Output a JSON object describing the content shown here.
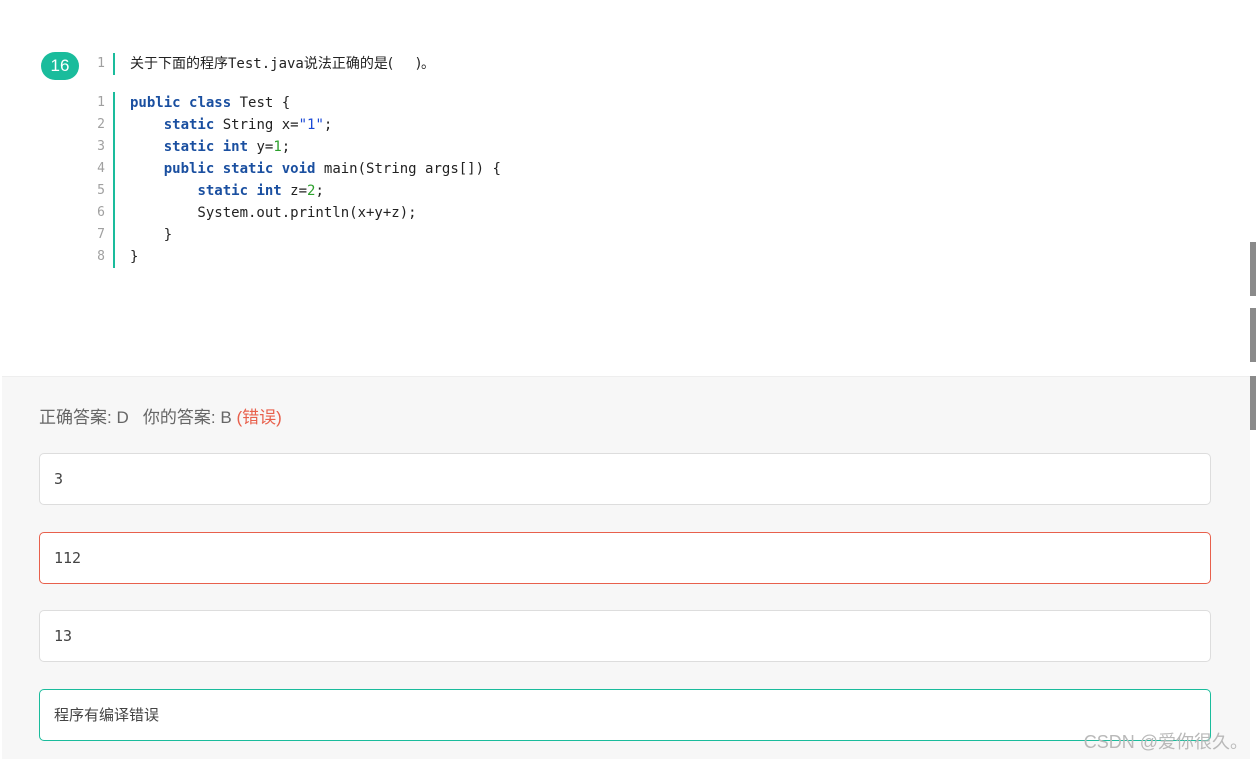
{
  "question": {
    "number": "16",
    "prompt_line_no": "1",
    "prompt_before": "关于下面的程序",
    "prompt_code": "Test.java",
    "prompt_after": "说法正确的是(     )。",
    "code_lines": [
      {
        "no": "1",
        "tokens": [
          {
            "t": "kw",
            "v": "public"
          },
          {
            "t": "p",
            "v": " "
          },
          {
            "t": "kw",
            "v": "class"
          },
          {
            "t": "p",
            "v": " Test {"
          }
        ]
      },
      {
        "no": "2",
        "tokens": [
          {
            "t": "p",
            "v": "    "
          },
          {
            "t": "kw",
            "v": "static"
          },
          {
            "t": "p",
            "v": " String x="
          },
          {
            "t": "str",
            "v": "\"1\""
          },
          {
            "t": "p",
            "v": ";"
          }
        ]
      },
      {
        "no": "3",
        "tokens": [
          {
            "t": "p",
            "v": "    "
          },
          {
            "t": "kw",
            "v": "static"
          },
          {
            "t": "p",
            "v": " "
          },
          {
            "t": "kw",
            "v": "int"
          },
          {
            "t": "p",
            "v": " y="
          },
          {
            "t": "num",
            "v": "1"
          },
          {
            "t": "p",
            "v": ";"
          }
        ]
      },
      {
        "no": "4",
        "tokens": [
          {
            "t": "p",
            "v": "    "
          },
          {
            "t": "kw",
            "v": "public"
          },
          {
            "t": "p",
            "v": " "
          },
          {
            "t": "kw",
            "v": "static"
          },
          {
            "t": "p",
            "v": " "
          },
          {
            "t": "kw",
            "v": "void"
          },
          {
            "t": "p",
            "v": " main(String args[]) {"
          }
        ]
      },
      {
        "no": "5",
        "tokens": [
          {
            "t": "p",
            "v": "        "
          },
          {
            "t": "kw",
            "v": "static"
          },
          {
            "t": "p",
            "v": " "
          },
          {
            "t": "kw",
            "v": "int"
          },
          {
            "t": "p",
            "v": " z="
          },
          {
            "t": "num",
            "v": "2"
          },
          {
            "t": "p",
            "v": ";"
          }
        ]
      },
      {
        "no": "6",
        "tokens": [
          {
            "t": "p",
            "v": "        System.out.println(x+y+z);"
          }
        ]
      },
      {
        "no": "7",
        "tokens": [
          {
            "t": "p",
            "v": "    }"
          }
        ]
      },
      {
        "no": "8",
        "tokens": [
          {
            "t": "p",
            "v": "}"
          }
        ]
      }
    ]
  },
  "result": {
    "correct_label": "正确答案: D",
    "your_label": "你的答案: B",
    "status": "(错误)"
  },
  "options": [
    {
      "text": "3",
      "state": "normal"
    },
    {
      "text": "112",
      "state": "selected-wrong"
    },
    {
      "text": "13",
      "state": "normal"
    },
    {
      "text": "程序有编译错误",
      "state": "correct"
    }
  ],
  "colors": {
    "accent": "#1abc9c",
    "wrong": "#e8604c",
    "keyword": "#1a4fa0",
    "string": "#1a49d6",
    "number": "#2ca02c"
  },
  "watermark": "CSDN @爱你很久。"
}
